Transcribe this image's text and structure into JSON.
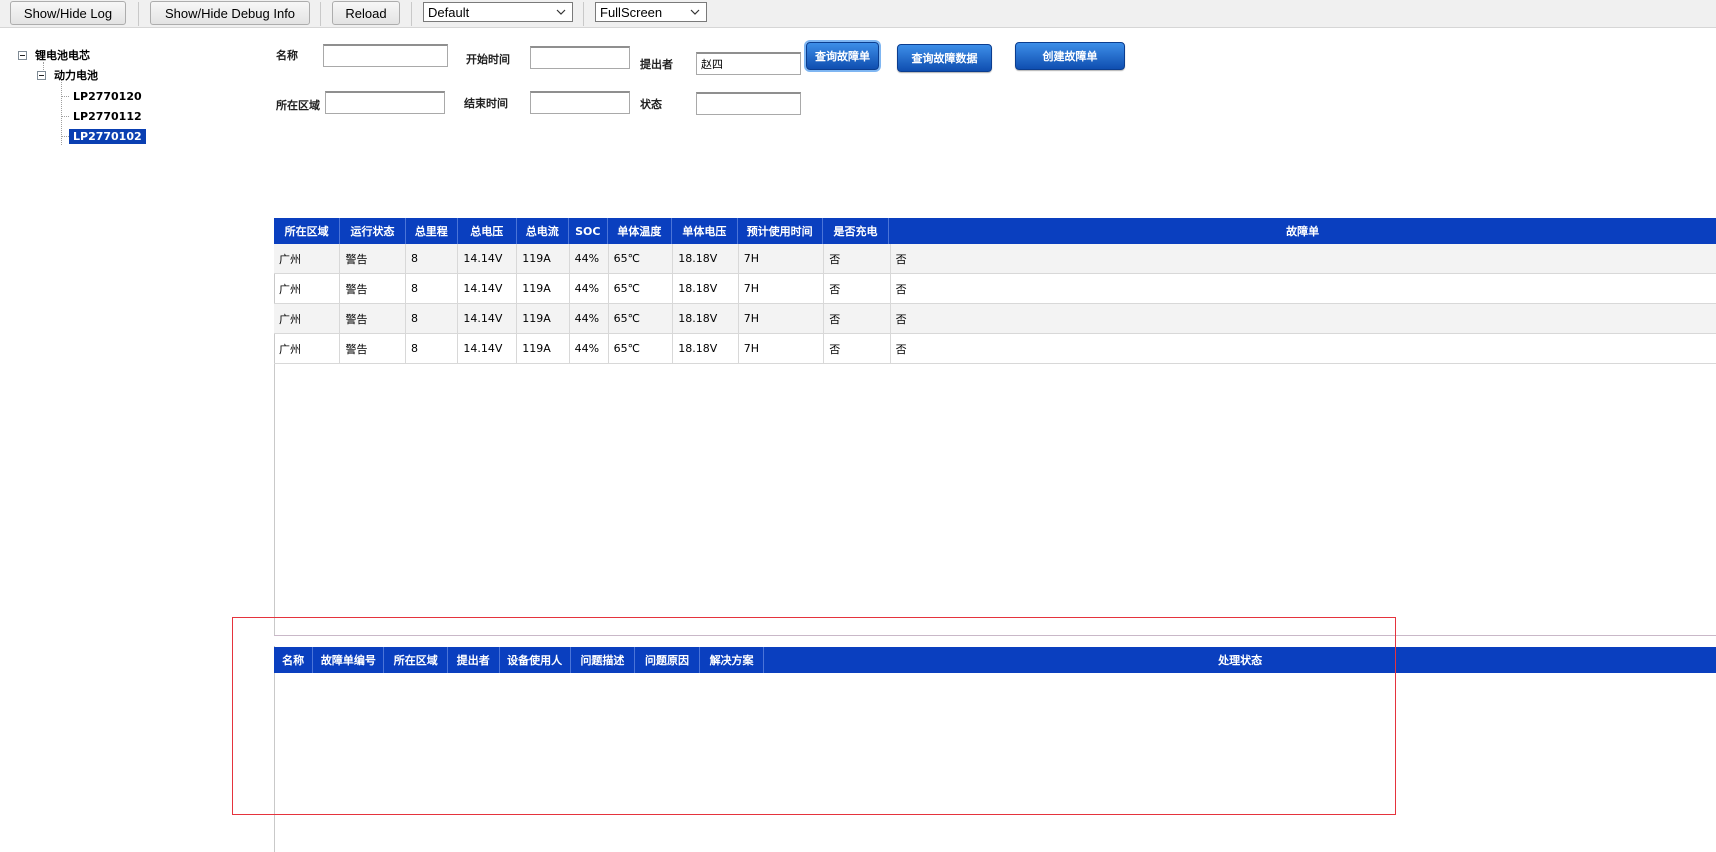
{
  "toolbar": {
    "show_hide_log": "Show/Hide Log",
    "show_hide_debug": "Show/Hide Debug Info",
    "reload": "Reload",
    "theme_select": "Default",
    "mode_select": "FullScreen"
  },
  "tree": {
    "root": "锂电池电芯",
    "child": "动力电池",
    "items": [
      "LP2770120",
      "LP2770112",
      "LP2770102"
    ],
    "selected_index": 2
  },
  "form": {
    "name_label": "名称",
    "name_value": "",
    "start_time_label": "开始时间",
    "start_time_value": "",
    "submitter_label": "提出者",
    "submitter_value": "赵四",
    "region_label": "所在区域",
    "region_value": "",
    "end_time_label": "结束时间",
    "end_time_value": "",
    "status_label": "状态",
    "status_value": "",
    "btn_query_fault_order": "查询故障单",
    "btn_query_fault_data": "查询故障数据",
    "btn_create_fault_order": "创建故障单"
  },
  "main_grid": {
    "columns": [
      "所在区域",
      "运行状态",
      "总里程",
      "总电压",
      "总电流",
      "SOC",
      "单体温度",
      "单体电压",
      "预计使用时间",
      "是否充电",
      "故障单"
    ],
    "rows": [
      [
        "广州",
        "警告",
        "8",
        "14.14V",
        "119A",
        "44%",
        "65℃",
        "18.18V",
        "7H",
        "否",
        "否"
      ],
      [
        "广州",
        "警告",
        "8",
        "14.14V",
        "119A",
        "44%",
        "65℃",
        "18.18V",
        "7H",
        "否",
        "否"
      ],
      [
        "广州",
        "警告",
        "8",
        "14.14V",
        "119A",
        "44%",
        "65℃",
        "18.18V",
        "7H",
        "否",
        "否"
      ],
      [
        "广州",
        "警告",
        "8",
        "14.14V",
        "119A",
        "44%",
        "65℃",
        "18.18V",
        "7H",
        "否",
        "否"
      ]
    ]
  },
  "fault_grid": {
    "columns": [
      "名称",
      "故障单编号",
      "所在区域",
      "提出者",
      "设备使用人",
      "问题描述",
      "问题原因",
      "解决方案",
      "处理状态"
    ],
    "rows": []
  },
  "colors": {
    "header_blue": "#0a3fbf",
    "button_blue": "#1a5cc4",
    "highlight_red": "#e5333d",
    "selected_tree": "#0a3fb2"
  }
}
